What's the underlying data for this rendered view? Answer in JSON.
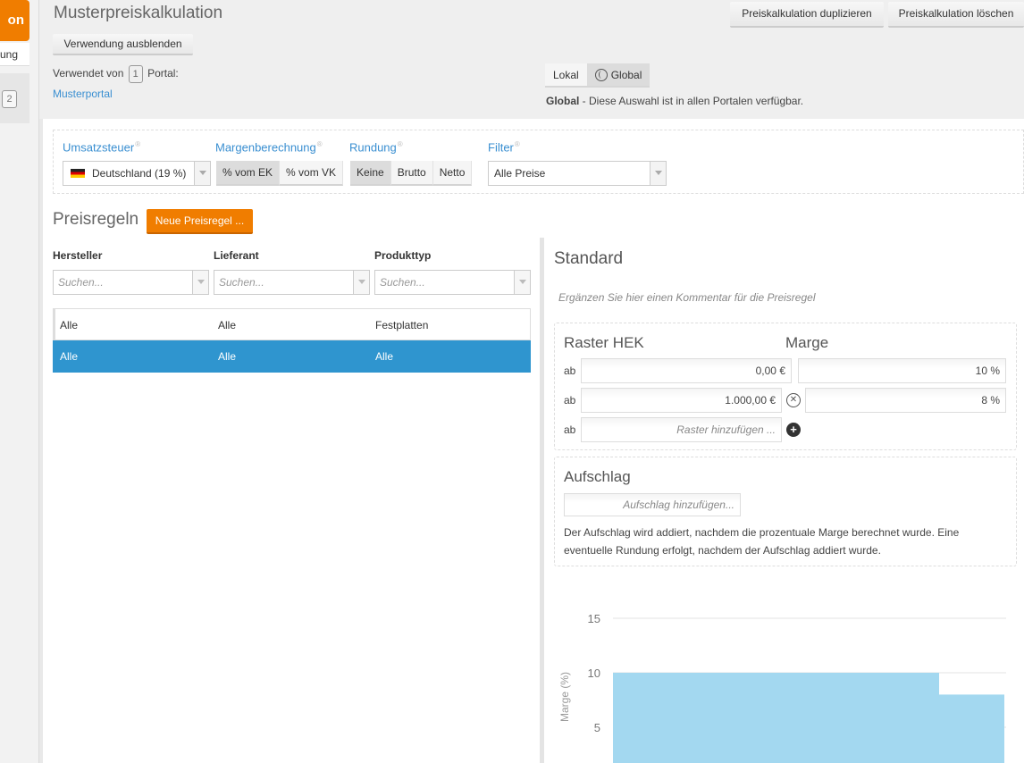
{
  "sidebar": {
    "orange_label": "on",
    "text_item": "ung",
    "badge": "2"
  },
  "header": {
    "title": "Musterpreiskalkulation",
    "duplicate_button": "Preiskalkulation duplizieren",
    "delete_button": "Preiskalkulation löschen",
    "hide_usage_button": "Verwendung ausblenden",
    "used_by_prefix": "Verwendet von",
    "used_by_count": "1",
    "used_by_suffix": "Portal:",
    "portal_link": "Musterportal",
    "scope_local": "Lokal",
    "scope_global": "Global",
    "global_desc_bold": "Global",
    "global_desc_rest": " - Diese Auswahl ist in allen Portalen verfügbar."
  },
  "filters": {
    "vat_label": "Umsatzsteuer",
    "vat_value": "Deutschland (19 %)",
    "margin_label": "Margenberechnung",
    "margin_options": [
      "% vom EK",
      "% vom VK"
    ],
    "margin_selected": 0,
    "rounding_label": "Rundung",
    "rounding_options": [
      "Keine",
      "Brutto",
      "Netto"
    ],
    "rounding_selected": 0,
    "filter_label": "Filter",
    "filter_value": "Alle Preise"
  },
  "rules": {
    "title": "Preisregeln",
    "new_button": "Neue Preisregel ...",
    "columns": [
      "Hersteller",
      "Lieferant",
      "Produkttyp"
    ],
    "search_placeholder": "Suchen...",
    "rows": [
      {
        "hersteller": "Alle",
        "lieferant": "Alle",
        "produkttyp": "Festplatten",
        "selected": false
      },
      {
        "hersteller": "Alle",
        "lieferant": "Alle",
        "produkttyp": "Alle",
        "selected": true
      }
    ]
  },
  "detail": {
    "title": "Standard",
    "comment_placeholder": "Ergänzen Sie hier einen Kommentar für die Preisregel",
    "raster_title": "Raster HEK",
    "margin_title": "Marge",
    "ab_label": "ab",
    "tiers": [
      {
        "from": "0,00 €",
        "margin": "10 %"
      },
      {
        "from": "1.000,00 €",
        "margin": "8 %"
      }
    ],
    "add_tier_placeholder": "Raster hinzufügen ...",
    "surcharge_title": "Aufschlag",
    "surcharge_placeholder": "Aufschlag hinzufügen...",
    "surcharge_note": "Der Aufschlag wird addiert, nachdem die prozentuale Marge berechnet wurde. Eine eventuelle Rundung erfolgt, nachdem der Aufschlag addiert wurde."
  },
  "chart_data": {
    "type": "area",
    "ylabel": "Marge (%)",
    "yticks": [
      5,
      10,
      15
    ],
    "ylim": [
      0,
      16
    ],
    "x": [
      0,
      1000,
      1200
    ],
    "values": [
      10,
      8
    ],
    "color": "#a3d8f0",
    "grid": true
  }
}
